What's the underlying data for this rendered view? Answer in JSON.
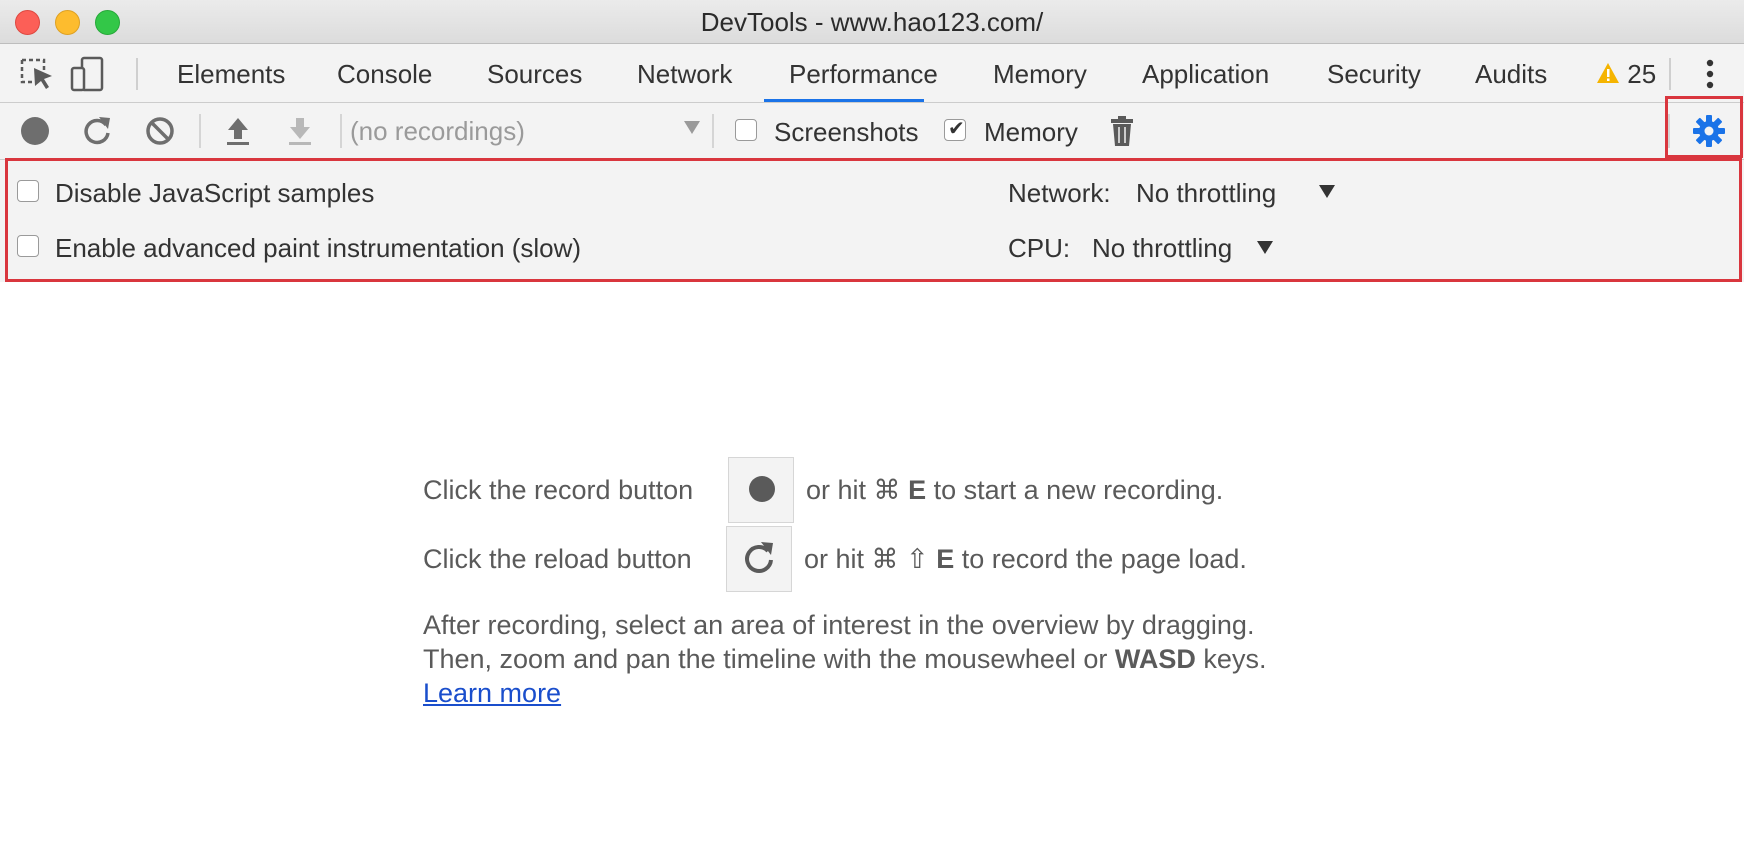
{
  "window": {
    "title": "DevTools - www.hao123.com/"
  },
  "tabs": [
    {
      "label": "Elements"
    },
    {
      "label": "Console"
    },
    {
      "label": "Sources"
    },
    {
      "label": "Network"
    },
    {
      "label": "Performance",
      "active": true
    },
    {
      "label": "Memory"
    },
    {
      "label": "Application"
    },
    {
      "label": "Security"
    },
    {
      "label": "Audits"
    }
  ],
  "warnings": {
    "count": "25",
    "icon": "warning-triangle-icon"
  },
  "toolbar": {
    "recordings_placeholder": "(no recordings)",
    "screenshots_label": "Screenshots",
    "screenshots_checked": false,
    "memory_label": "Memory",
    "memory_checked": true,
    "icons": [
      "record-icon",
      "reload-icon",
      "clear-icon",
      "upload-icon",
      "download-icon",
      "trash-icon",
      "gear-icon"
    ]
  },
  "settings": {
    "disable_js_label": "Disable JavaScript samples",
    "advanced_paint_label": "Enable advanced paint instrumentation (slow)",
    "network_label": "Network:",
    "network_value": "No throttling",
    "cpu_label": "CPU:",
    "cpu_value": "No throttling"
  },
  "landing": {
    "record_prefix": "Click the record button",
    "record_or_hit": "or hit",
    "record_shortcut": "⌘",
    "record_key": "E",
    "record_suffix": "to start a new recording.",
    "reload_prefix": "Click the reload button",
    "reload_or_hit": "or hit",
    "reload_shortcut": "⌘ ⇧",
    "reload_key": "E",
    "reload_suffix": "to record the page load.",
    "after_line1": "After recording, select an area of interest in the overview by dragging.",
    "after_line2_prefix": "Then, zoom and pan the timeline with the mousewheel or",
    "after_line2_bold": "WASD",
    "after_line2_suffix": "keys.",
    "learn_more": "Learn more"
  },
  "colors": {
    "accent_blue": "#1a73e8",
    "highlight_red": "#d9363e",
    "warning_yellow": "#f5b400"
  }
}
